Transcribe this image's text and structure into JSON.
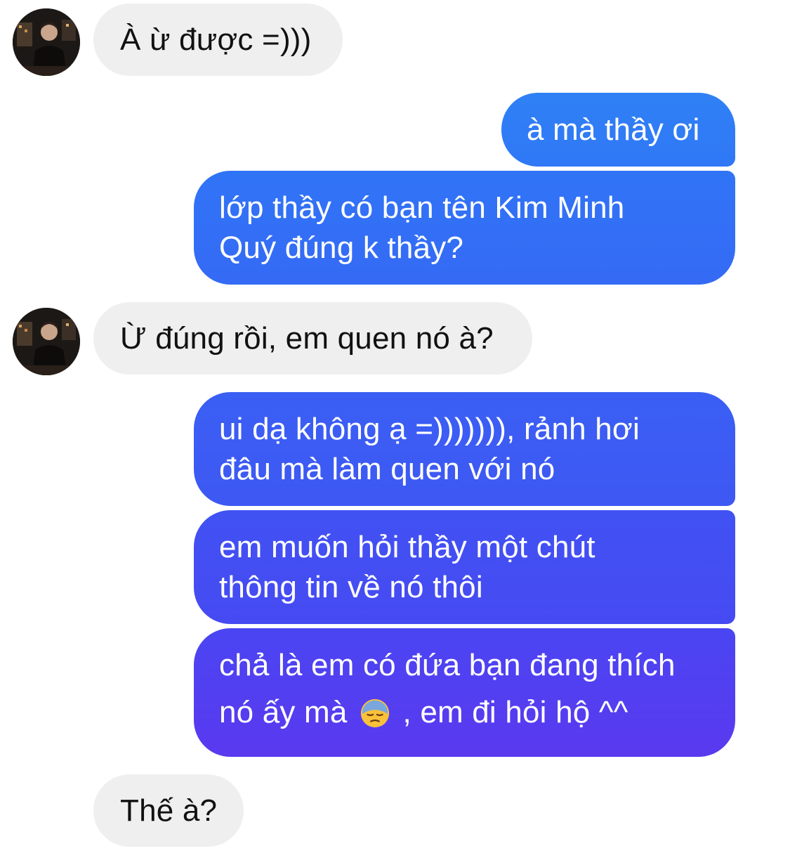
{
  "conversation": {
    "messages": [
      {
        "id": "m1",
        "sender": "contact",
        "lines": [
          "À ừ được =)))"
        ]
      },
      {
        "id": "m2",
        "sender": "me",
        "lines": [
          "à mà thầy ơi"
        ]
      },
      {
        "id": "m3",
        "sender": "me",
        "lines": [
          "lớp thầy có bạn tên Kim Minh",
          "Quý đúng k thầy?"
        ]
      },
      {
        "id": "m4",
        "sender": "contact",
        "lines": [
          "Ừ đúng rồi, em quen nó à?"
        ]
      },
      {
        "id": "m5",
        "sender": "me",
        "lines": [
          "ui dạ không ạ =))))))), rảnh hơi",
          "đâu mà làm quen với nó"
        ]
      },
      {
        "id": "m6",
        "sender": "me",
        "lines": [
          "em muốn hỏi thầy một chút",
          "thông tin về nó thôi"
        ]
      },
      {
        "id": "m7",
        "sender": "me",
        "line1": "chả là em có đứa bạn đang thích",
        "line2_before_emoji": "nó ấy mà",
        "emoji": "downcast-sweat-face-emoji",
        "line2_after_emoji": ", em đi hỏi hộ ^^"
      },
      {
        "id": "m8",
        "sender": "contact",
        "lines": [
          "Thế à?"
        ]
      }
    ]
  },
  "colors": {
    "incoming_bubble": "#efefef",
    "incoming_text": "#111111",
    "outgoing_text": "#ffffff",
    "outgoing_gradient_top": "#2f7cf6",
    "outgoing_gradient_bottom": "#5b3bee"
  }
}
